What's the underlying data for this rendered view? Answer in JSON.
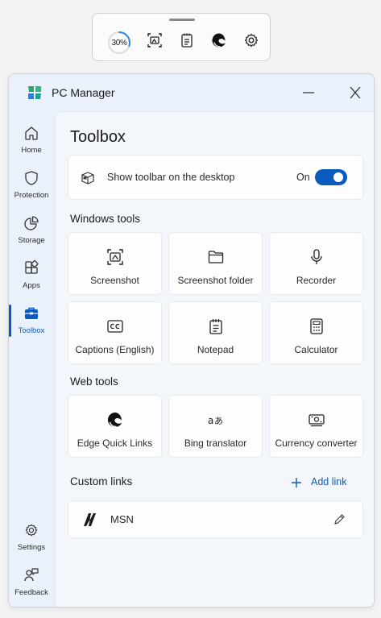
{
  "floating_toolbar": {
    "memory_percent": "30%",
    "memory_fraction": 0.3,
    "items": [
      "screenshot-icon",
      "notepad-icon",
      "edge-icon",
      "settings-icon"
    ]
  },
  "window": {
    "title": "PC Manager"
  },
  "nav": {
    "items": [
      {
        "label": "Home",
        "icon": "home-icon"
      },
      {
        "label": "Protection",
        "icon": "shield-icon"
      },
      {
        "label": "Storage",
        "icon": "pie-chart-icon"
      },
      {
        "label": "Apps",
        "icon": "apps-icon"
      },
      {
        "label": "Toolbox",
        "icon": "toolbox-icon",
        "active": true
      }
    ],
    "bottom": [
      {
        "label": "Settings",
        "icon": "gear-icon"
      },
      {
        "label": "Feedback",
        "icon": "feedback-icon"
      }
    ]
  },
  "page": {
    "title": "Toolbox",
    "toolbar_setting": {
      "label": "Show toolbar on the desktop",
      "state": "On"
    },
    "windows_tools": {
      "title": "Windows tools",
      "tiles": [
        "Screenshot",
        "Screenshot folder",
        "Recorder",
        "Captions (English)",
        "Notepad",
        "Calculator"
      ]
    },
    "web_tools": {
      "title": "Web tools",
      "tiles": [
        "Edge Quick Links",
        "Bing translator",
        "Currency converter"
      ]
    },
    "custom_links": {
      "title": "Custom links",
      "add_label": "Add link",
      "links": [
        {
          "name": "MSN"
        }
      ]
    }
  },
  "colors": {
    "accent": "#0a5bbd",
    "window_bg": "#eaf1fa",
    "content_bg": "#f3f7fc",
    "card_bg": "#fdfdfd"
  }
}
